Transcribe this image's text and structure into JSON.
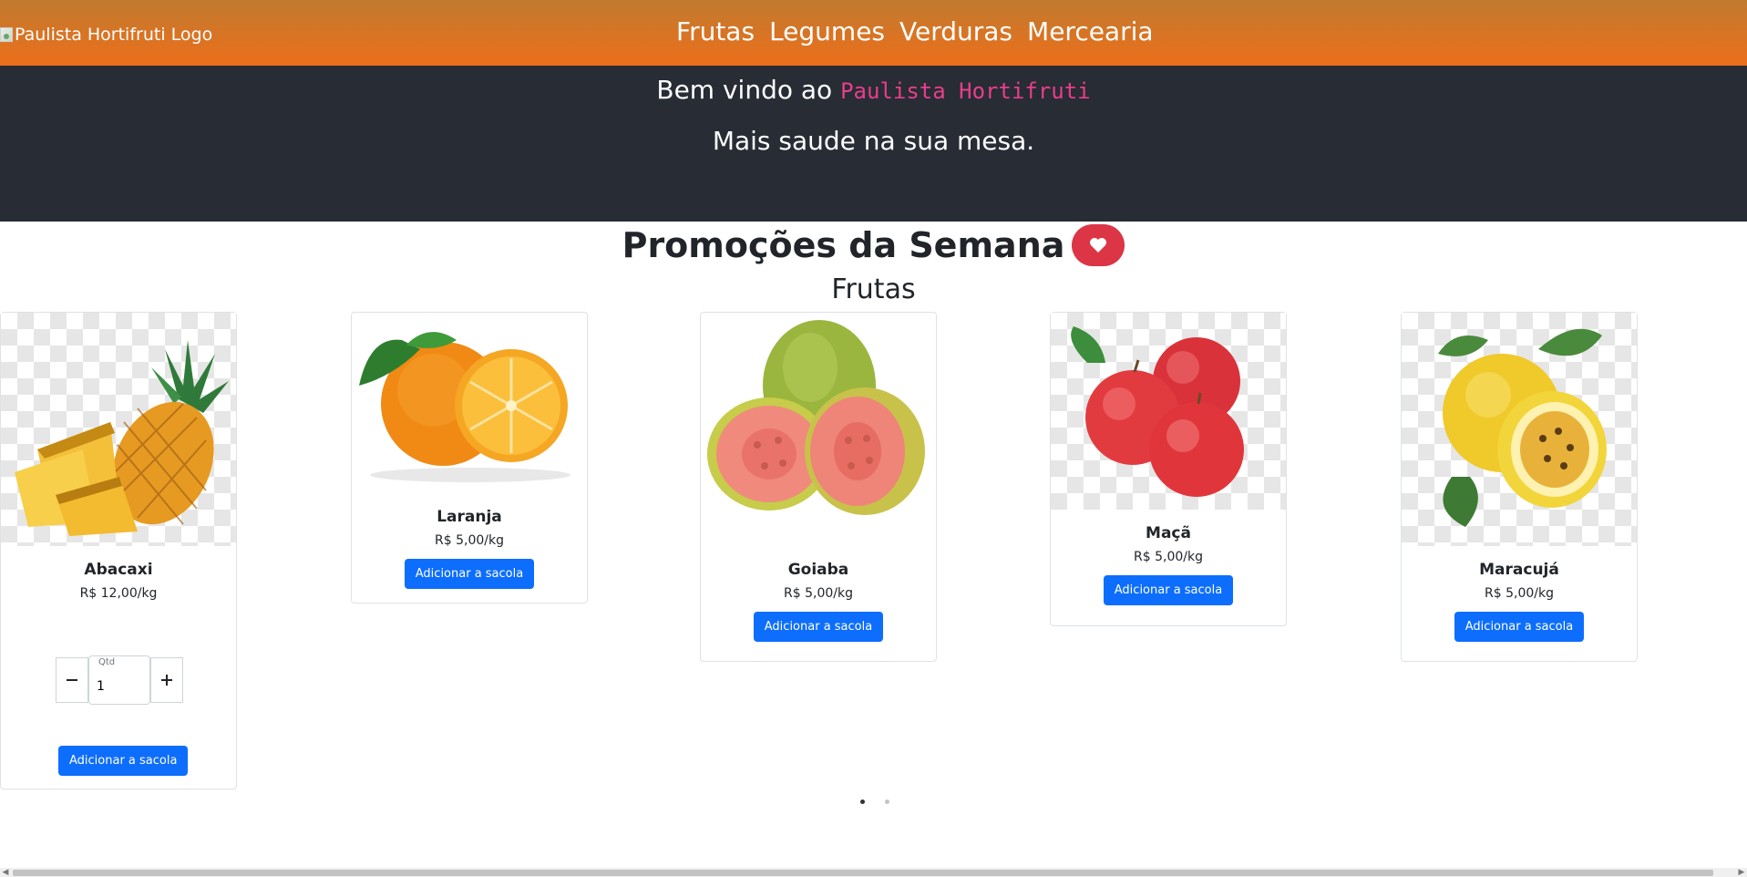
{
  "header": {
    "logo_alt": "Paulista Hortifruti Logo",
    "nav": [
      "Frutas",
      "Legumes",
      "Verduras",
      "Mercearia"
    ]
  },
  "hero": {
    "welcome": "Bem vindo ao",
    "brand": "Paulista Hortifruti",
    "tagline": "Mais saude na sua mesa."
  },
  "promotions": {
    "title": "Promoções da Semana",
    "category": "Frutas"
  },
  "products": [
    {
      "name": "Abacaxi",
      "price": "R$ 12,00/kg",
      "button": "Adicionar a sacola",
      "image": "pineapple"
    },
    {
      "name": "Laranja",
      "price": "R$ 5,00/kg",
      "button": "Adicionar a sacola",
      "image": "orange"
    },
    {
      "name": "Goiaba",
      "price": "R$ 5,00/kg",
      "button": "Adicionar a sacola",
      "image": "guava"
    },
    {
      "name": "Maçã",
      "price": "R$ 5,00/kg",
      "button": "Adicionar a sacola",
      "image": "apple"
    },
    {
      "name": "Maracujá",
      "price": "R$ 5,00/kg",
      "button": "Adicionar a sacola",
      "image": "passion-fruit"
    }
  ],
  "quantity": {
    "label": "Qtd",
    "value": "1"
  },
  "colors": {
    "header_start": "#c07a2f",
    "header_end": "#ed6f1b",
    "hero_bg": "#282c34",
    "brand_code": "#e83e8c",
    "primary_button": "#0d6efd",
    "heart_badge": "#dc3545"
  }
}
